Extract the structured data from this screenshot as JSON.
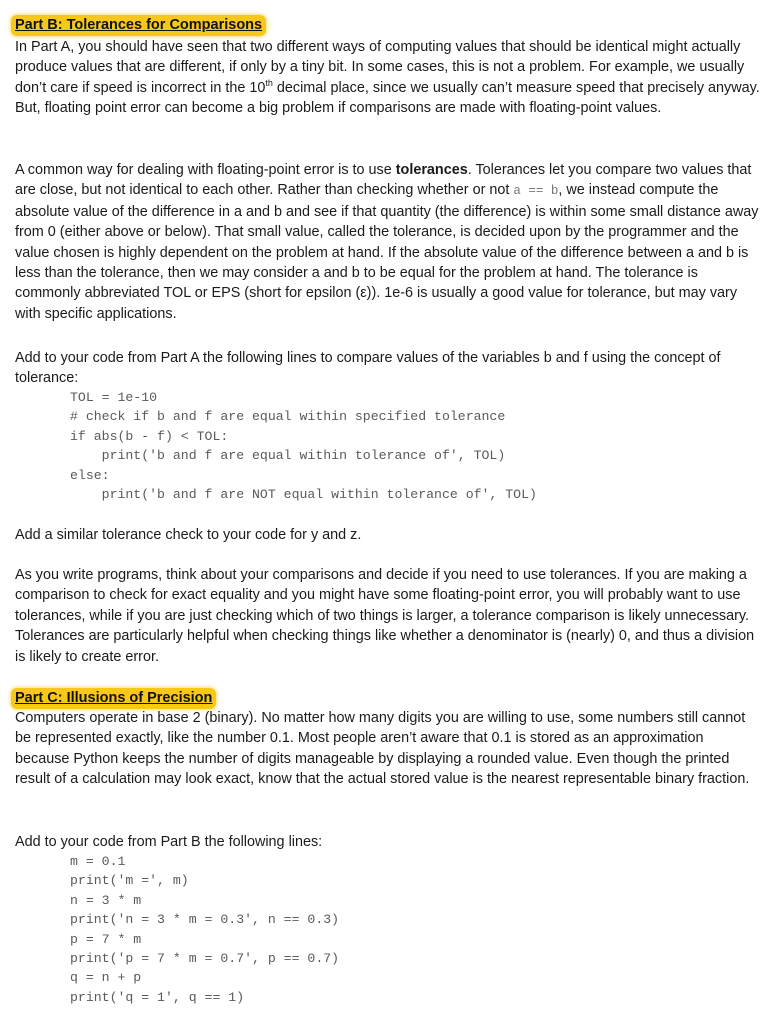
{
  "part_b": {
    "heading": "Part B: Tolerances for Comparisons",
    "para1_a": "In Part A, you should have seen that two different ways of computing values that should be identical might actually produce values that are different, if only by a tiny bit. In some cases, this is not a problem. For example, we usually don’t care if speed is incorrect in the 10",
    "para1_sup": "th",
    "para1_b": " decimal place, since we usually can’t measure speed that precisely anyway. But, floating point error can become a big problem if comparisons are made with floating-point values.",
    "para2_a": "A common way for dealing with floating-point error is to use ",
    "para2_bold": "tolerances",
    "para2_b": ". Tolerances let you compare two values that are close, but not identical to each other. Rather than checking whether or not ",
    "para2_code": "a == b",
    "para2_c": ", we instead compute the absolute value of the difference in a and b and see if that quantity (the difference) is within some small distance away from 0 (either above or below). That small value, called the tolerance, is decided upon by the programmer and the value chosen is highly dependent on the problem at hand. If the absolute value of the difference between a and b is less than the tolerance, then we may consider a and b to be equal for the problem at hand. The tolerance is commonly abbreviated TOL or EPS (short for epsilon (ε)). 1e-6 is usually a good value for tolerance, but may vary with specific applications.",
    "para3": "Add to your code from Part A the following lines to compare values of the variables b and f using the concept of tolerance:",
    "code_lines": [
      "TOL = 1e-10",
      "# check if b and f are equal within specified tolerance",
      "if abs(b - f) < TOL:",
      "    print('b and f are equal within tolerance of', TOL)",
      "else:",
      "    print('b and f are NOT equal within tolerance of', TOL)"
    ],
    "para4": "Add a similar tolerance check to your code for y and z.",
    "para5": "As you write programs, think about your comparisons and decide if you need to use tolerances. If you are making a comparison to check for exact equality and you might have some floating-point error, you will probably want to use tolerances, while if you are just checking which of two things is larger, a tolerance comparison is likely unnecessary. Tolerances are particularly helpful when checking things like whether a denominator is (nearly) 0, and thus a division is likely to create error."
  },
  "part_c": {
    "heading": "Part C: Illusions of Precision",
    "para1": "Computers operate in base 2 (binary). No matter how many digits you are willing to use, some numbers still cannot be represented exactly, like the number 0.1. Most people aren’t aware that 0.1 is stored as an approximation because Python keeps the number of digits manageable by displaying a rounded value. Even though the printed result of a calculation may look exact, know that the actual stored value is the nearest representable binary fraction.",
    "para2": "Add to your code from Part B the following lines:",
    "code_lines": [
      "m = 0.1",
      "print('m =', m)",
      "n = 3 * m",
      "print('n = 3 * m = 0.3', n == 0.3)",
      "p = 7 * m",
      "print('p = 7 * m = 0.7', p == 0.7)",
      "q = n + p",
      "print('q = 1', q == 1)"
    ]
  },
  "colors": {
    "heading_highlight": "#f7c81b",
    "code_text": "#5a5a5a"
  }
}
